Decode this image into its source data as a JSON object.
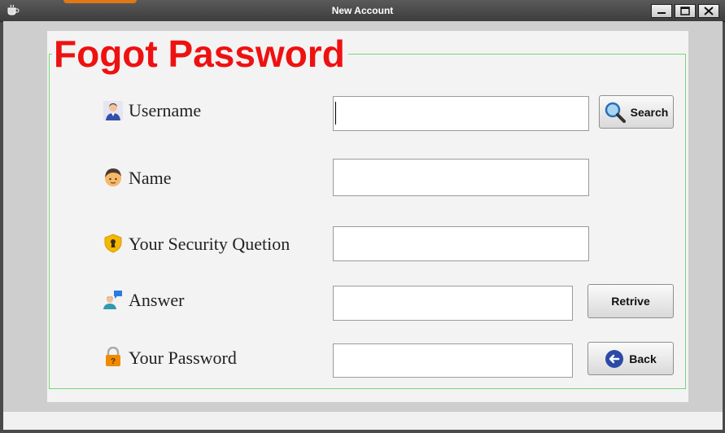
{
  "window": {
    "title": "New Account"
  },
  "form": {
    "heading": "Fogot Password",
    "fields": [
      {
        "label": "Username",
        "icon": "user-icon",
        "value": ""
      },
      {
        "label": "Name",
        "icon": "person-face-icon",
        "value": ""
      },
      {
        "label": "Your Security Quetion",
        "icon": "shield-keyhole-icon",
        "value": ""
      },
      {
        "label": "Answer",
        "icon": "user-chat-icon",
        "value": ""
      },
      {
        "label": "Your Password",
        "icon": "padlock-icon",
        "value": ""
      }
    ],
    "buttons": {
      "search": "Search",
      "retrive": "Retrive",
      "back": "Back"
    }
  },
  "colors": {
    "heading": "#ee1111",
    "frame_border": "#77d777",
    "titlebar": "#3d3d3d"
  }
}
